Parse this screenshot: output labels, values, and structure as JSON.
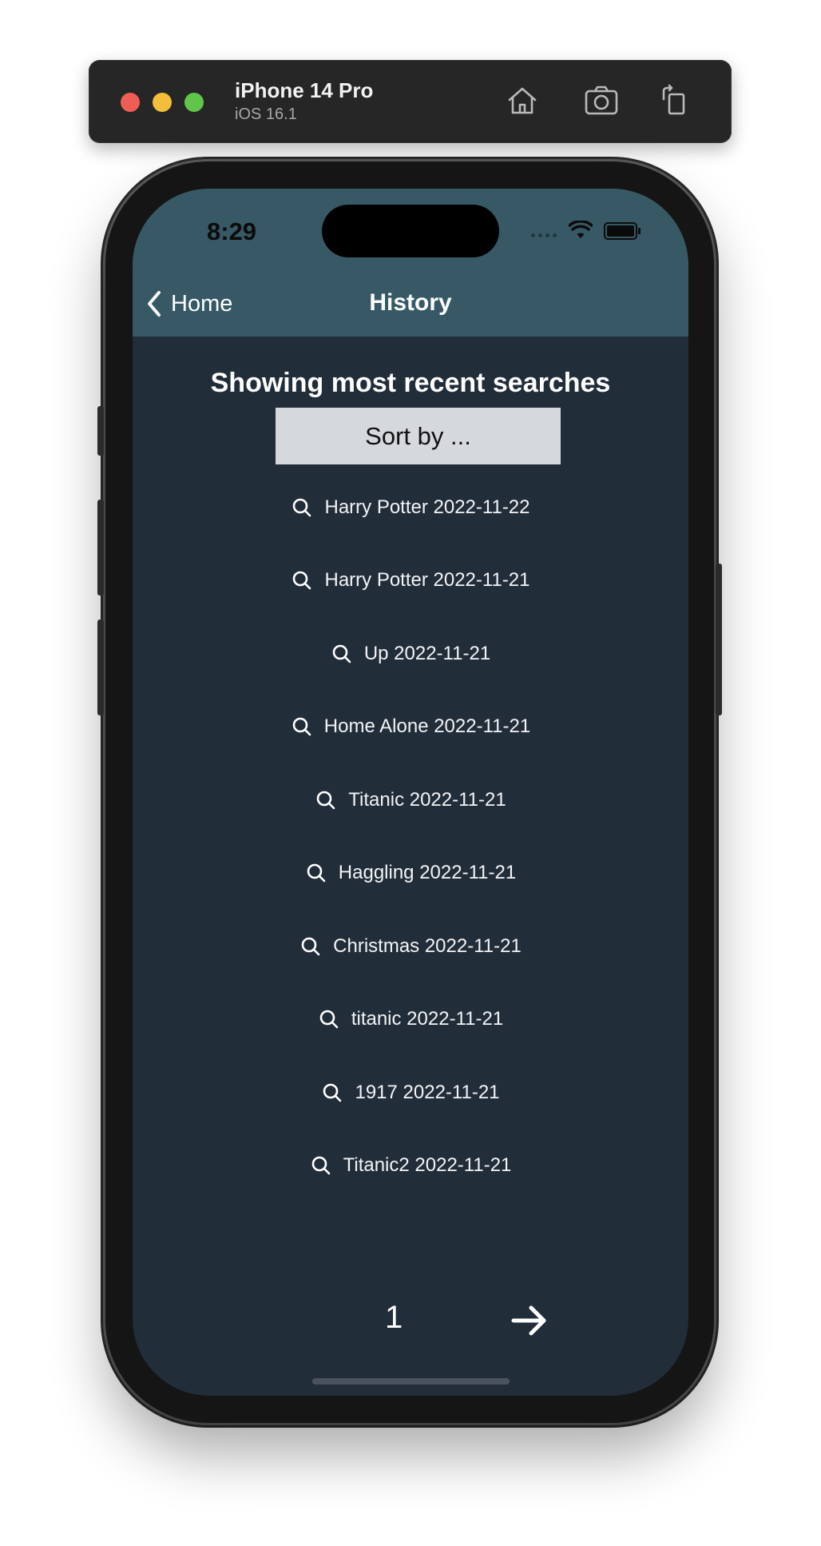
{
  "simulator": {
    "device_name": "iPhone 14 Pro",
    "os_version": "iOS 16.1"
  },
  "status_bar": {
    "time": "8:29"
  },
  "navbar": {
    "back_label": "Home",
    "title": "History"
  },
  "main": {
    "heading": "Showing most recent searches",
    "sort_label": "Sort by ...",
    "history_items": [
      {
        "label": "Harry Potter 2022-11-22"
      },
      {
        "label": "Harry Potter 2022-11-21"
      },
      {
        "label": "Up 2022-11-21"
      },
      {
        "label": "Home Alone 2022-11-21"
      },
      {
        "label": "Titanic 2022-11-21"
      },
      {
        "label": "Haggling 2022-11-21"
      },
      {
        "label": "Christmas 2022-11-21"
      },
      {
        "label": "titanic 2022-11-21"
      },
      {
        "label": "1917 2022-11-21"
      },
      {
        "label": "Titanic2 2022-11-21"
      }
    ]
  },
  "pagination": {
    "current_page": "1"
  },
  "colors": {
    "navbar_bg": "#375965",
    "screen_bg": "#222d3a",
    "sort_button_bg": "#d5d8dd"
  }
}
